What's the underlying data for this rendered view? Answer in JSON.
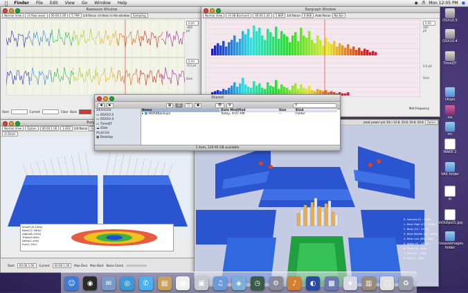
{
  "menubar": {
    "apple": "",
    "app": "Finder",
    "items": [
      "File",
      "Edit",
      "View",
      "Go",
      "Window",
      "Help"
    ],
    "clock": "Mon 12:05 PM"
  },
  "raw_window": {
    "title": "Rawwave Window",
    "toolbar": [
      "Normal View",
      "ch Raw wave",
      "00:00.1.00",
      "5.799",
      "1/4 Rerun",
      "ch Hann in the window",
      "Sampling"
    ],
    "axis_right": [
      "0.00",
      "-400",
      "pV",
      "",
      "0.00",
      "-0.0 pV"
    ],
    "gain_label": "Gain",
    "footer": [
      "Start",
      "Current",
      "Clear",
      "Back",
      "Set Mode",
      "Normal",
      "Crosshair"
    ]
  },
  "bar_window": {
    "title": "Bargraph Window",
    "toolbar": [
      "Normal View",
      "ch 48 Bar(nonl)",
      "00:00.1.00",
      "5.869",
      "1/4 Rerun",
      "0.666",
      "Auto Rerun",
      "No Bar"
    ],
    "axis_right": [
      "0.00",
      "300",
      "pV",
      "0.0 pV"
    ],
    "gain_label": "Gain",
    "mid_freq": "Mid Frequency",
    "spectrum_heights": [
      6,
      9,
      11,
      9,
      13,
      8,
      12,
      14,
      18,
      12,
      15,
      22,
      19,
      24,
      16,
      27,
      22,
      25,
      18,
      14,
      24,
      21,
      17,
      26,
      15,
      22,
      19,
      17,
      12,
      18,
      21,
      13,
      25,
      18,
      16,
      22,
      14,
      11,
      18,
      14,
      9,
      16,
      12,
      10,
      13,
      8,
      11,
      9,
      7,
      10,
      6,
      8,
      5,
      7,
      4,
      6,
      5,
      3,
      4,
      3
    ],
    "spectrum2_heights": [
      3,
      4,
      5,
      4,
      6,
      5,
      7,
      9,
      12,
      8,
      11,
      16,
      10,
      8,
      7,
      13,
      9,
      11,
      7,
      6,
      12,
      9,
      8,
      14,
      6,
      10,
      8,
      7,
      5,
      9,
      11,
      6,
      10,
      7,
      6,
      9,
      5,
      4,
      6,
      5,
      4,
      5,
      3,
      4,
      3,
      2,
      3,
      2,
      2,
      3
    ]
  },
  "finder": {
    "title": "Shared",
    "sidebar_devices_header": "DEVICES",
    "devices": [
      "OSX10.5",
      "OSX10.4",
      "TimeQT",
      "iDisk"
    ],
    "sidebar_places_header": "PLACES",
    "places": [
      "Desktop"
    ],
    "columns": [
      "Name",
      "Date Modified",
      "Size",
      "Kind"
    ],
    "rows": [
      {
        "name": "IBVA4Backups",
        "date": "Today, 4:07 AM",
        "size": "--",
        "kind": "Folder"
      }
    ],
    "status": "1 item, 129.95 GB available",
    "search_placeholder": ""
  },
  "three_d_window": {
    "title": "IBVA 3D",
    "option_btn": "Option",
    "bar_caption": "peak power (pV 10) / 10.8, 10.8, 10.8, 10.8",
    "legend": [
      "0. Gamma (0 - 40Hz)",
      "1. Beta High (23 - 30Hz)",
      "2. Beta (15 - 23Hz)",
      "3. Beta Middle (12 - 15Hz)",
      "4. Beta Low (8M-12Hz)",
      "5. Alpha (8 - 12Hz)",
      "6. Theta (4 - 8Hz)",
      "7. Delta (1 - 4Hz)",
      "8. Eye (1 - 2Hz)"
    ]
  },
  "left_3d_window": {
    "title": "Bargraph 3D",
    "toolbar": [
      "Normal View",
      "Option",
      "00:00.1.00",
      "1.824",
      "1/4 Rerun",
      "0.666",
      "No Bar"
    ],
    "toolbar2": [
      "ch Brain"
    ],
    "labels": [
      "Eye(1-2Hz)",
      "Delta(1-4Hz)",
      "Theta(4-8Hz)",
      "Alpha(8-12Hz)",
      "Beta(12-30Hz)",
      "SmaM (8-15Hz)"
    ],
    "footer": [
      "Start",
      "00:00.1.00",
      "Current",
      "00:00.1.00",
      "Max-Zero",
      "Max-Start",
      "Noise Check"
    ]
  },
  "desktop_icons": [
    "OSX10.5",
    "OSX10.4",
    "TimeQT",
    "ckups",
    "ea",
    "ev",
    "MAKE 2",
    "VAX folder",
    "ib",
    "abOutput1.jpg",
    "utesaveimages folder"
  ],
  "dock_icons": [
    "finder-icon",
    "dashboard-icon",
    "mail-icon",
    "safari-icon",
    "ichat-icon",
    "addressbook-icon",
    "ical-icon",
    "preview-icon",
    "itunes-icon",
    "iphoto-icon",
    "timemachine-icon",
    "sysprefs-icon",
    "guitar-icon",
    "app-icon",
    "spaces-icon",
    "star-icon",
    "stacks-icon",
    "docs-icon",
    "trash-icon"
  ],
  "colors": {
    "wave": [
      "#1b24c8",
      "#2d7ed8",
      "#27b04a",
      "#a8c920",
      "#e0b020",
      "#e06020",
      "#d02020",
      "#a020a0"
    ],
    "accent_red": "#d42020",
    "plot_bg": "#f2f4e6",
    "blue3d": "#2b55d0"
  }
}
